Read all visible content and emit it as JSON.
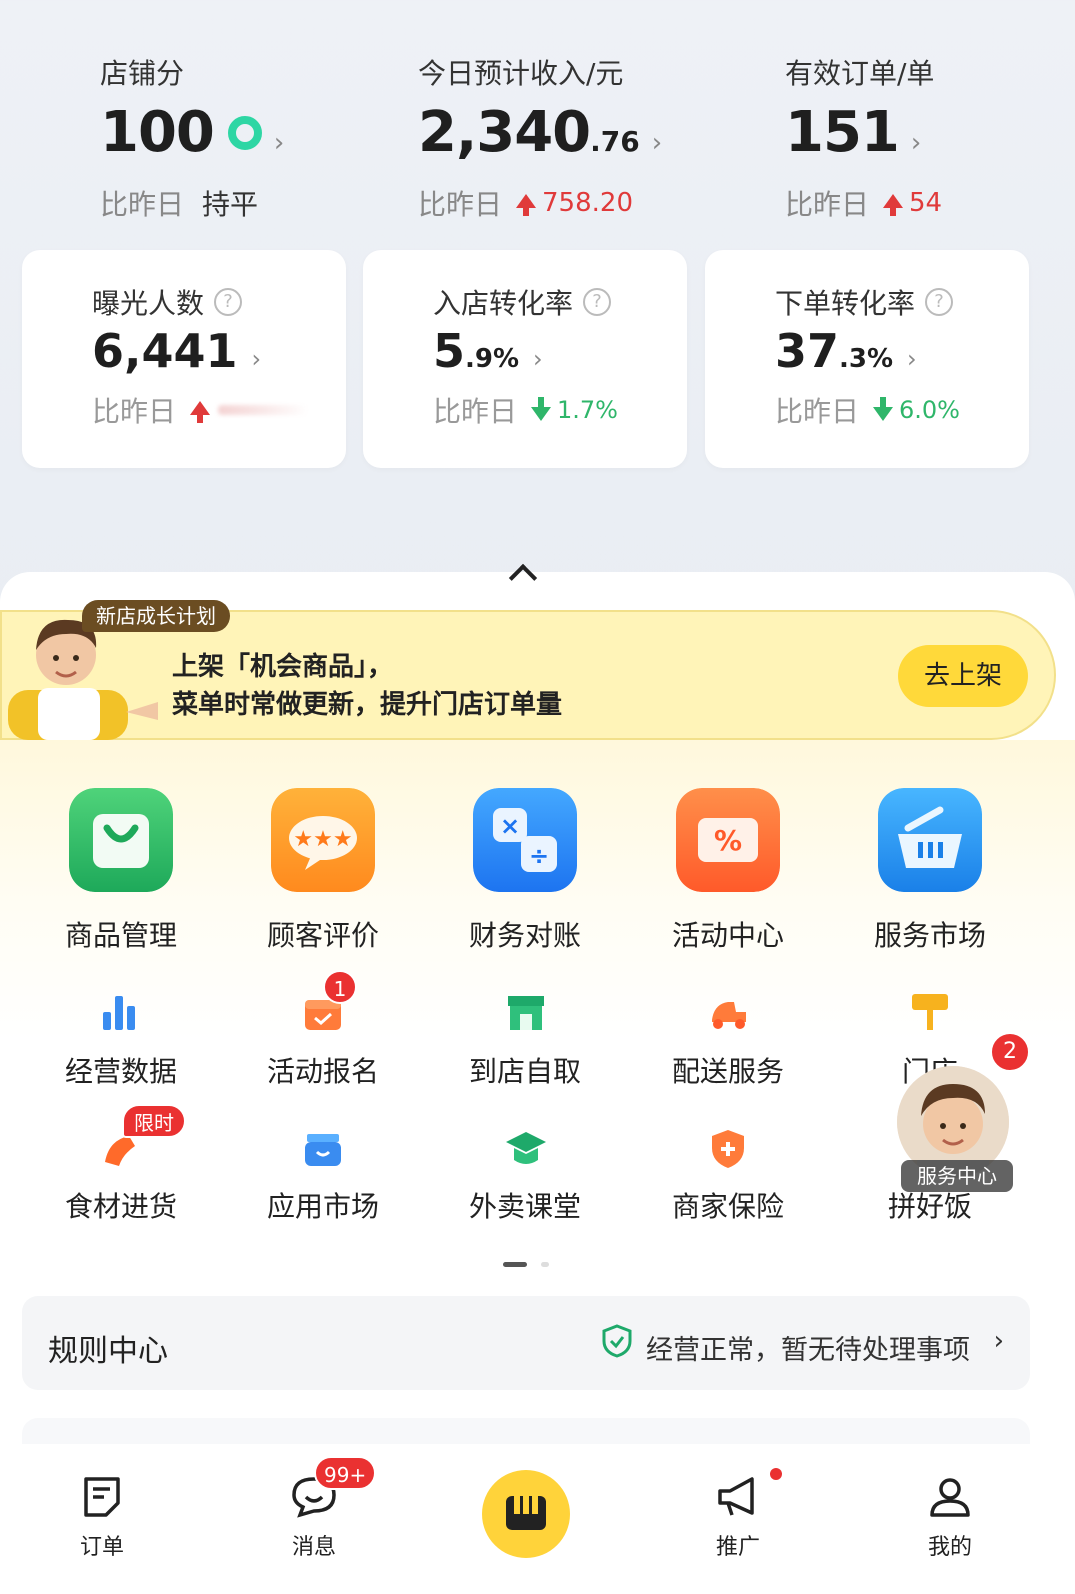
{
  "stats": [
    {
      "label": "店铺分",
      "value": "100",
      "suffix": "",
      "compare_label": "比昨日",
      "compare_value": "持平"
    },
    {
      "label": "今日预计收入/元",
      "value": "2,340",
      "suffix": ".76",
      "compare_label": "比昨日",
      "compare_value": "758.20"
    },
    {
      "label": "有效订单/单",
      "value": "151",
      "suffix": "",
      "compare_label": "比昨日",
      "compare_value": "54"
    }
  ],
  "cards": [
    {
      "label": "曝光人数",
      "value": "6,441",
      "suffix": "",
      "compare_label": "比昨日",
      "compare_value": ""
    },
    {
      "label": "入店转化率",
      "value": "5",
      "suffix": ".9%",
      "compare_label": "比昨日",
      "compare_value": "1.7%"
    },
    {
      "label": "下单转化率",
      "value": "37",
      "suffix": ".3%",
      "compare_label": "比昨日",
      "compare_value": "6.0%"
    }
  ],
  "banner": {
    "tag": "新店成长计划",
    "line1": "上架「机会商品」，",
    "line2": "菜单时常做更新，提升门店订单量",
    "button": "去上架"
  },
  "main_tools": [
    "商品管理",
    "顾客评价",
    "财务对账",
    "活动中心",
    "服务市场"
  ],
  "tools_row2": [
    "经营数据",
    "活动报名",
    "到店自取",
    "配送服务",
    "门店"
  ],
  "tools_row3": [
    "食材进货",
    "应用市场",
    "外卖课堂",
    "商家保险",
    "拼好饭"
  ],
  "badges": {
    "activity_signup": "1",
    "ingredients": "限时",
    "service_center": "2",
    "messages": "99+"
  },
  "service_center_label": "服务中心",
  "rule_center": {
    "title": "规则中心",
    "status": "经营正常，暂无待处理事项"
  },
  "tabbar": [
    "订单",
    "消息",
    "推广",
    "我的"
  ],
  "colors": {
    "up": "#e03a3a",
    "down": "#2fb66a",
    "accent": "#ffd33a"
  }
}
